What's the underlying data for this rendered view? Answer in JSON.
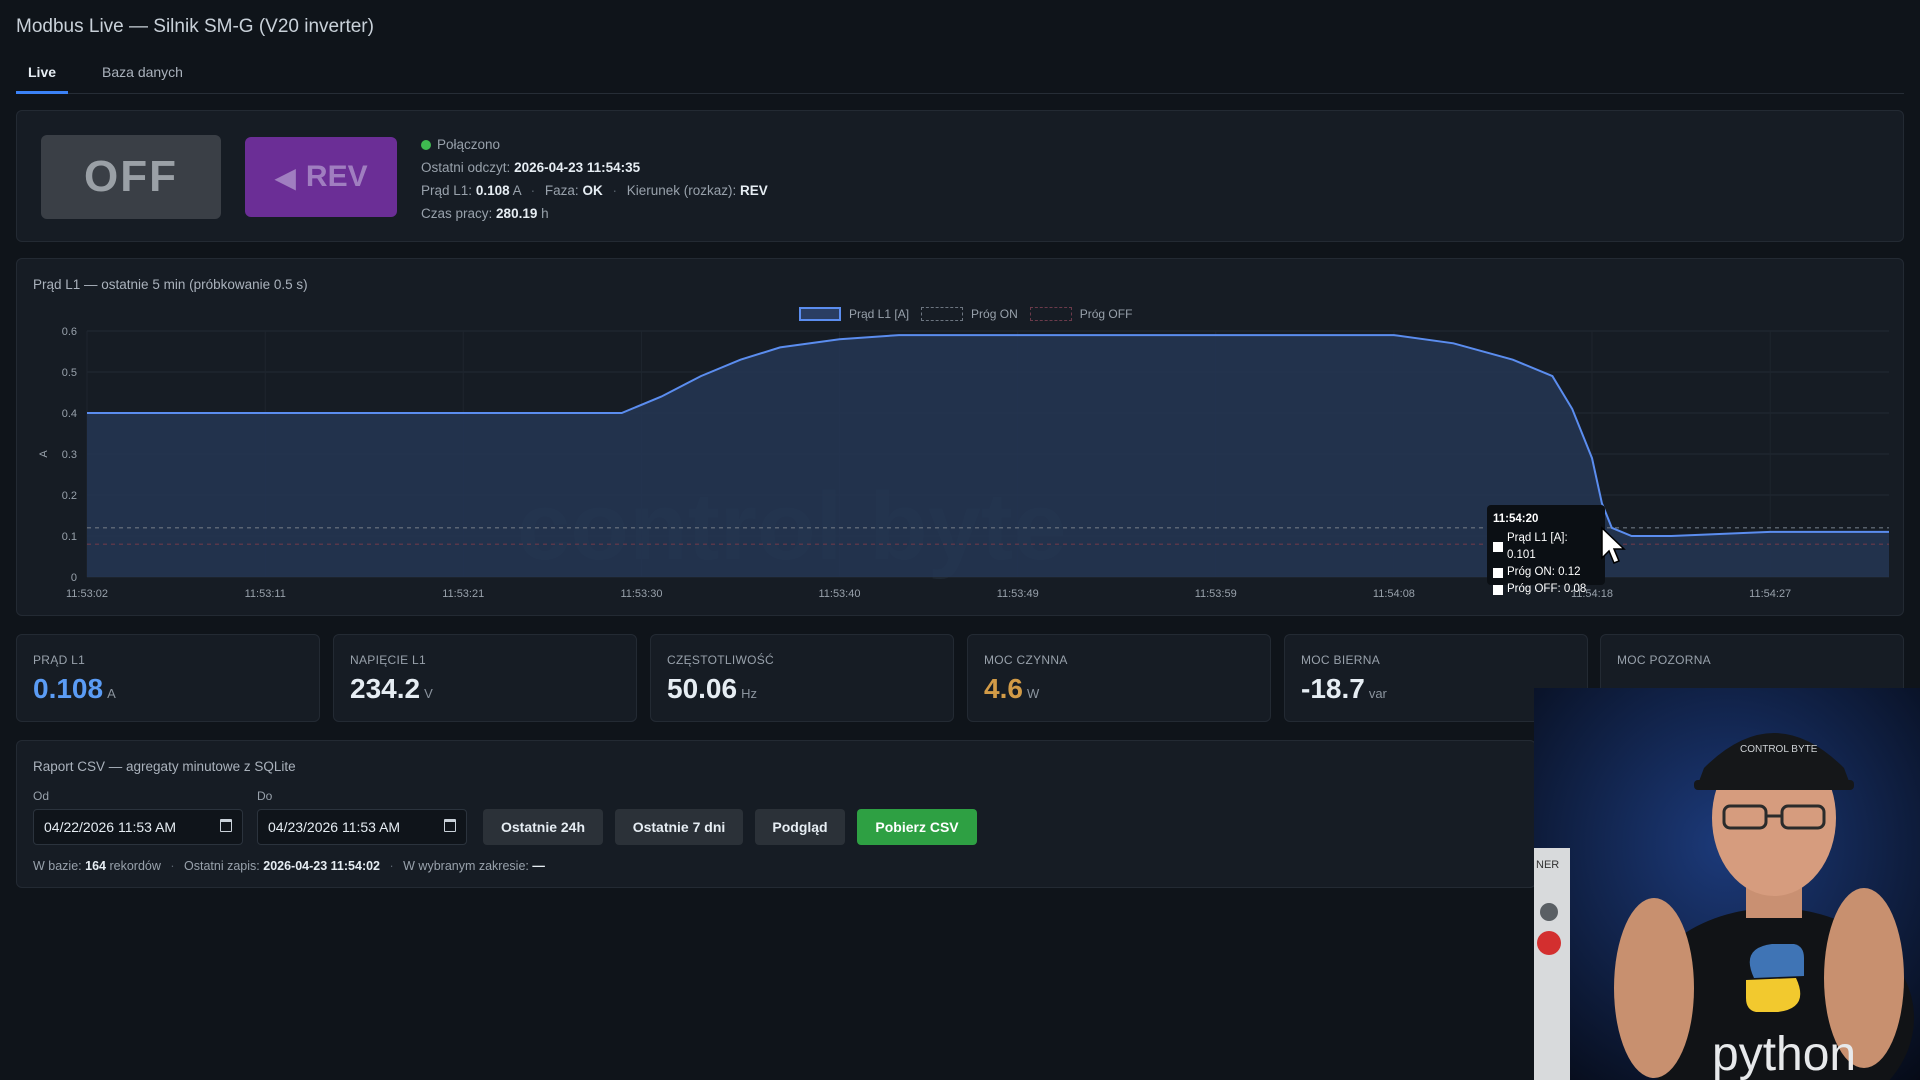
{
  "app": {
    "title": "Modbus Live — Silnik SM-G (V20 inverter)"
  },
  "tabs": [
    {
      "label": "Live",
      "active": true
    },
    {
      "label": "Baza danych",
      "active": false
    }
  ],
  "control": {
    "off_label": "OFF",
    "rev_label": "REV",
    "status": "Połączono",
    "last_read_label": "Ostatni odczyt:",
    "last_read_value": "2026-04-23 11:54:35",
    "current_label": "Prąd L1:",
    "current_value": "0.108",
    "current_unit": "A",
    "phase_label": "Faza:",
    "phase_value": "OK",
    "direction_label": "Kierunek (rozkaz):",
    "direction_value": "REV",
    "runtime_label": "Czas pracy:",
    "runtime_value": "280.19",
    "runtime_unit": "h"
  },
  "chart_panel": {
    "title": "Prąd L1 — ostatnie 5 min (próbkowanie 0.5 s)",
    "legend": [
      "Prąd L1 [A]",
      "Próg ON",
      "Próg OFF"
    ],
    "ylabel": "A",
    "watermark": "control byte",
    "tooltip": {
      "time": "11:54:20",
      "rows": [
        "Prąd L1 [A]: 0.101",
        "Próg ON: 0.12",
        "Próg OFF: 0.08"
      ]
    }
  },
  "chart_data": {
    "type": "area",
    "title": "Prąd L1 — ostatnie 5 min (próbkowanie 0.5 s)",
    "ylabel": "A",
    "ylim": [
      0,
      0.6
    ],
    "yticks": [
      0,
      0.1,
      0.2,
      0.3,
      0.4,
      0.5,
      0.6
    ],
    "xticks": [
      "11:53:02",
      "11:53:11",
      "11:53:21",
      "11:53:30",
      "11:53:40",
      "11:53:49",
      "11:53:59",
      "11:54:08",
      "11:54:18",
      "11:54:27"
    ],
    "x": [
      "11:53:02",
      "11:53:11",
      "11:53:21",
      "11:53:29",
      "11:53:31",
      "11:53:33",
      "11:53:35",
      "11:53:37",
      "11:53:40",
      "11:53:43",
      "11:53:46",
      "11:53:49",
      "11:53:54",
      "11:53:59",
      "11:54:04",
      "11:54:08",
      "11:54:11",
      "11:54:14",
      "11:54:16",
      "11:54:17",
      "11:54:18",
      "11:54:18.5",
      "11:54:19",
      "11:54:20",
      "11:54:22",
      "11:54:27",
      "11:54:33"
    ],
    "series": [
      {
        "name": "Prąd L1 [A]",
        "values": [
          0.4,
          0.4,
          0.4,
          0.4,
          0.44,
          0.49,
          0.53,
          0.56,
          0.58,
          0.59,
          0.59,
          0.59,
          0.59,
          0.59,
          0.59,
          0.59,
          0.57,
          0.53,
          0.49,
          0.41,
          0.29,
          0.18,
          0.12,
          0.1,
          0.1,
          0.11,
          0.11
        ]
      },
      {
        "name": "Próg ON",
        "values": [
          0.12,
          0.12,
          0.12,
          0.12,
          0.12,
          0.12,
          0.12,
          0.12,
          0.12,
          0.12,
          0.12,
          0.12,
          0.12,
          0.12,
          0.12,
          0.12,
          0.12,
          0.12,
          0.12,
          0.12,
          0.12,
          0.12,
          0.12,
          0.12,
          0.12,
          0.12,
          0.12
        ]
      },
      {
        "name": "Próg OFF",
        "values": [
          0.08,
          0.08,
          0.08,
          0.08,
          0.08,
          0.08,
          0.08,
          0.08,
          0.08,
          0.08,
          0.08,
          0.08,
          0.08,
          0.08,
          0.08,
          0.08,
          0.08,
          0.08,
          0.08,
          0.08,
          0.08,
          0.08,
          0.08,
          0.08,
          0.08,
          0.08,
          0.08
        ]
      }
    ],
    "colors": {
      "line": "#5b8def",
      "fill": "#243654",
      "on": "#6c7580",
      "off": "#6b3a4a"
    },
    "grid": true,
    "legend": "top-center"
  },
  "cards": [
    {
      "label": "PRĄD L1",
      "value": "0.108",
      "unit": "A",
      "color": "#5b9cf5"
    },
    {
      "label": "NAPIĘCIE L1",
      "value": "234.2",
      "unit": "V",
      "color": "#e6edf3"
    },
    {
      "label": "CZĘSTOTLIWOŚĆ",
      "value": "50.06",
      "unit": "Hz",
      "color": "#e6edf3"
    },
    {
      "label": "MOC CZYNNA",
      "value": "4.6",
      "unit": "W",
      "color": "#d29b47"
    },
    {
      "label": "MOC BIERNA",
      "value": "-18.7",
      "unit": "var",
      "color": "#e6edf3"
    },
    {
      "label": "MOC POZORNA",
      "value": "",
      "unit": "",
      "color": "#e6edf3"
    }
  ],
  "report": {
    "title": "Raport CSV — agregaty minutowe z SQLite",
    "from_label": "Od",
    "from_value": "04/22/2026 11:53 AM",
    "to_label": "Do",
    "to_value": "04/23/2026 11:53 AM",
    "btn_24h": "Ostatnie 24h",
    "btn_7d": "Ostatnie 7 dni",
    "btn_preview": "Podgląd",
    "btn_download": "Pobierz CSV",
    "footer_db_label": "W bazie:",
    "footer_db_count": "164",
    "footer_db_suffix": "rekordów",
    "footer_last_label": "Ostatni zapis:",
    "footer_last_value": "2026-04-23 11:54:02",
    "footer_range_label": "W wybranym zakresie:",
    "footer_range_value": "—"
  },
  "webcam": {
    "cap_text": "CONTROL BYTE",
    "shirt_text": "python",
    "panel_text": "NER"
  }
}
